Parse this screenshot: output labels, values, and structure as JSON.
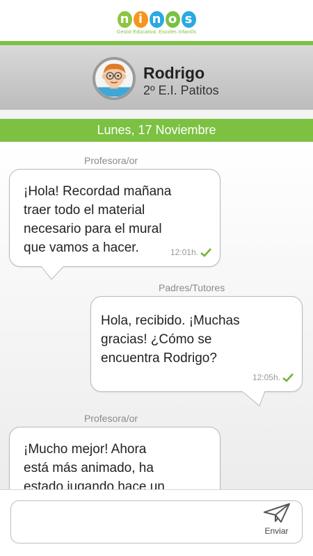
{
  "brand": {
    "logo_letters": [
      "n",
      "i",
      "n",
      "o",
      "s"
    ],
    "logo_colors": [
      "#8cc63f",
      "#f7941d",
      "#29a9e1",
      "#7ac143",
      "#29a9e1"
    ],
    "tagline": "Gestió Educativa: Escoles Infantils",
    "accent_color": "#7cc142"
  },
  "profile": {
    "name": "Rodrigo",
    "class": "2º E.I. Patitos"
  },
  "date_label": "Lunes, 17 Noviembre",
  "messages": [
    {
      "sender": "Profesora/or",
      "lines": [
        "¡Hola! Recordad mañana",
        "traer todo el material",
        "necesario para el mural",
        "que vamos a hacer."
      ],
      "time": "12:01h."
    },
    {
      "sender": "Padres/Tutores",
      "lines": [
        "Hola, recibido. ¡Muchas",
        "gracias! ¿Cómo se",
        "encuentra Rodrigo?"
      ],
      "time": "12:05h."
    },
    {
      "sender": "Profesora/or",
      "lines": [
        "¡Mucho mejor! Ahora",
        "está más animado, ha",
        "estado jugando hace un"
      ],
      "time": ""
    }
  ],
  "composer": {
    "placeholder": "",
    "send_label": "Enviar",
    "send_icon": "paper-plane-icon"
  }
}
